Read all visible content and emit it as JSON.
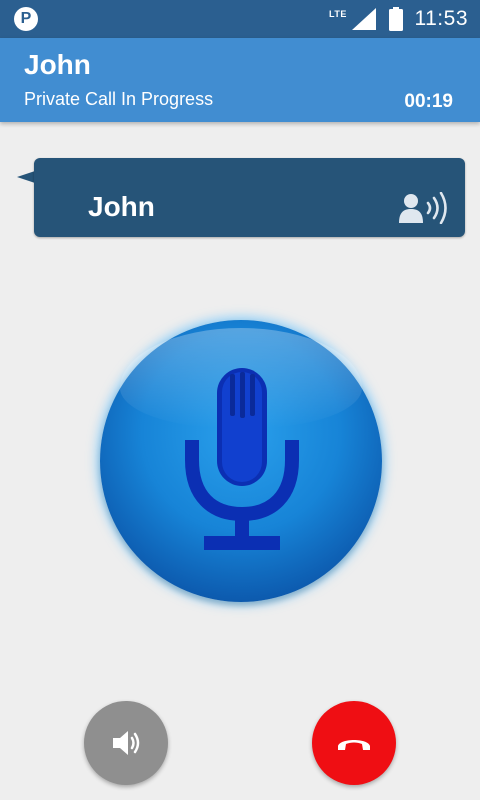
{
  "status_bar": {
    "app_icon": "P",
    "network": "LTE",
    "time": "11:53",
    "icons": [
      "app-p-icon",
      "signal-icon",
      "battery-icon"
    ]
  },
  "header": {
    "title": "John",
    "subtitle": "Private Call In Progress",
    "timer": "00:19"
  },
  "speaker_card": {
    "name": "John",
    "icon": "person-speaking-icon"
  },
  "controls": {
    "ptt_icon": "microphone-icon",
    "speaker_icon": "speaker-icon",
    "end_call_icon": "hang-up-icon"
  },
  "colors": {
    "status_bar": "#2b5f90",
    "header": "#418dd1",
    "bubble": "#265478",
    "ptt_button": "#1784d7",
    "speaker_button": "#8f8f8f",
    "end_call_button": "#ef0e13",
    "background": "#eeeeee"
  }
}
